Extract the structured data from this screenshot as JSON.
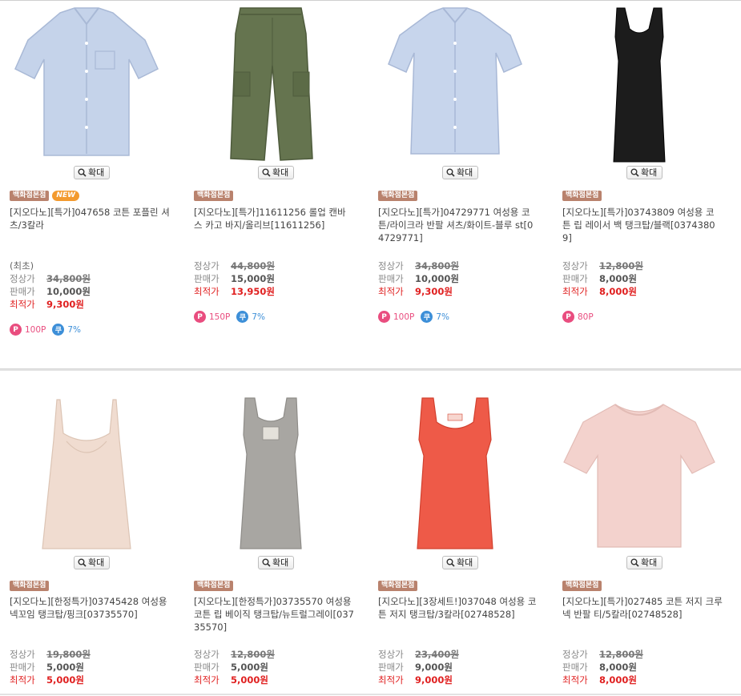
{
  "zoom_label": "확대",
  "labels": {
    "original_note": "(최초)",
    "list_price": "정상가",
    "sale_price": "판매가",
    "best_price": "최적가"
  },
  "badges": {
    "store": "백화점본점",
    "new": "NEW"
  },
  "products": [
    {
      "title": "[지오다노][특가]047658 코튼 포플린 셔츠/3칼라",
      "list_price": "34,800원",
      "sale_price": "10,000원",
      "best_price": "9,300원",
      "points": "100P",
      "coupon": "7%",
      "has_new": true,
      "has_original_note": true,
      "colors": {
        "main": "#c5d3ea",
        "shade": "#a9b9d6"
      }
    },
    {
      "title": "[지오다노][특가]11611256 롤업 캔바스 카고 바지/올리브[11611256]",
      "list_price": "44,800원",
      "sale_price": "15,000원",
      "best_price": "13,950원",
      "points": "150P",
      "coupon": "7%",
      "colors": {
        "main": "#65744f",
        "shade": "#4e5b3c"
      }
    },
    {
      "title": "[지오다노][특가]04729771 여성용 코튼/라이크라 반팔 셔츠/화이트-블루 st[04729771]",
      "list_price": "34,800원",
      "sale_price": "10,000원",
      "best_price": "9,300원",
      "points": "100P",
      "coupon": "7%",
      "colors": {
        "main": "#c7d5ec",
        "shade": "#a8b8d6"
      }
    },
    {
      "title": "[지오다노][특가]03743809 여성용 코튼 립 레이서 백 탱크탑/블랙[03743809]",
      "list_price": "12,800원",
      "sale_price": "8,000원",
      "best_price": "8,000원",
      "points": "80P",
      "colors": {
        "main": "#1c1c1c",
        "shade": "#000000"
      }
    },
    {
      "title": "[지오다노][한정특가]03745428 여성용 넥꼬임 탱크탑/핑크[03735570]",
      "list_price": "19,800원",
      "sale_price": "5,000원",
      "best_price": "5,000원",
      "colors": {
        "main": "#f0dcd0",
        "shade": "#dcc4b4"
      }
    },
    {
      "title": "[지오다노][한정특가]03735570 여성용 코튼 립 베이직 탱크탑/뉴트럴그레이[03735570]",
      "list_price": "12,800원",
      "sale_price": "5,000원",
      "best_price": "5,000원",
      "colors": {
        "main": "#a8a6a2",
        "shade": "#8e8c88"
      }
    },
    {
      "title": "[지오다노][3장세트!]037048 여성용 코튼 저지 탱크탑/3칼라[02748528]",
      "list_price": "23,400원",
      "sale_price": "9,000원",
      "best_price": "9,000원",
      "colors": {
        "main": "#ee5a48",
        "shade": "#d2412f"
      }
    },
    {
      "title": "[지오다노][특가]027485 코튼 저지 크루넥 반팔 티/5칼라[02748528]",
      "list_price": "12,800원",
      "sale_price": "8,000원",
      "best_price": "8,000원",
      "colors": {
        "main": "#f3d2cd",
        "shade": "#e2bbb5"
      }
    }
  ]
}
